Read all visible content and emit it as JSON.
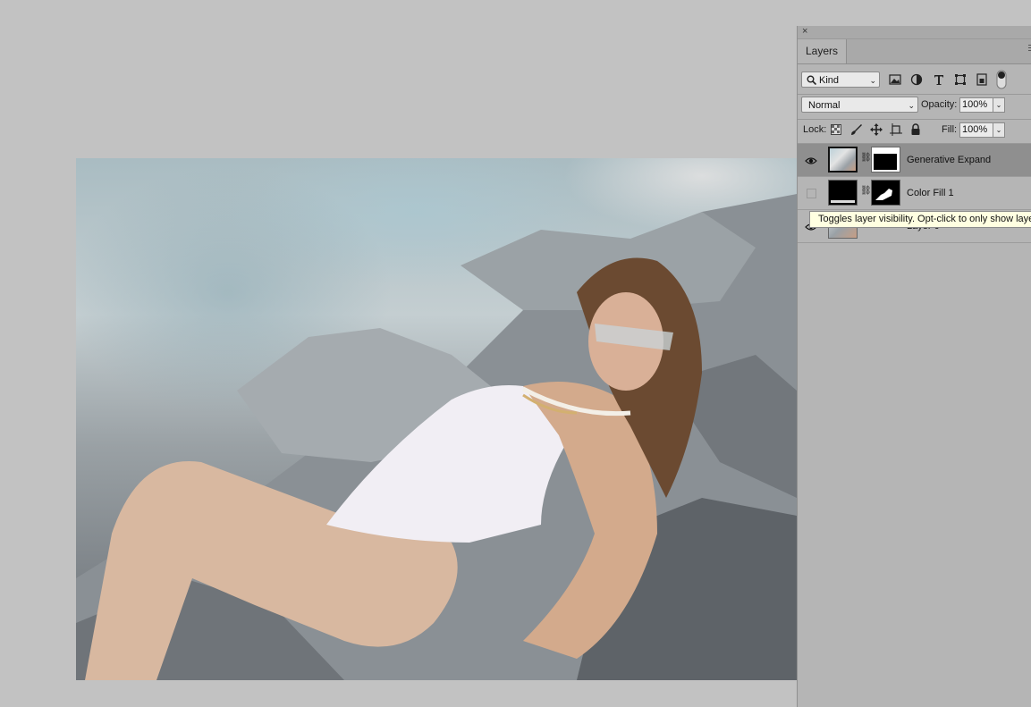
{
  "panel": {
    "close_glyph": "×",
    "tab_label": "Layers",
    "filter": {
      "kind_label": "Kind",
      "icons": [
        "image-filter-icon",
        "adjustment-filter-icon",
        "type-filter-icon",
        "shape-filter-icon",
        "smart-object-filter-icon",
        "filter-toggle-icon"
      ]
    },
    "blend_mode": "Normal",
    "opacity_label": "Opacity:",
    "opacity_value": "100%",
    "lock_label": "Lock:",
    "lock_icons": [
      "lock-transparent-pixels-icon",
      "lock-image-pixels-icon",
      "lock-position-icon",
      "lock-artboard-icon",
      "lock-all-icon"
    ],
    "fill_label": "Fill:",
    "fill_value": "100%",
    "layers": [
      {
        "name": "Generative Expand",
        "visible": true,
        "selected": true
      },
      {
        "name": "Color Fill 1",
        "visible": false,
        "selected": false
      },
      {
        "name": "Layer 0",
        "visible": true,
        "selected": false
      }
    ]
  },
  "tooltip": {
    "text": "Toggles layer visibility. Opt-click to only show layer"
  },
  "colors": {
    "workspace_bg": "#c2c2c2",
    "panel_bg": "#b5b5b5",
    "selected_row": "#8f8f8f",
    "tooltip_bg": "#ffffe1"
  }
}
